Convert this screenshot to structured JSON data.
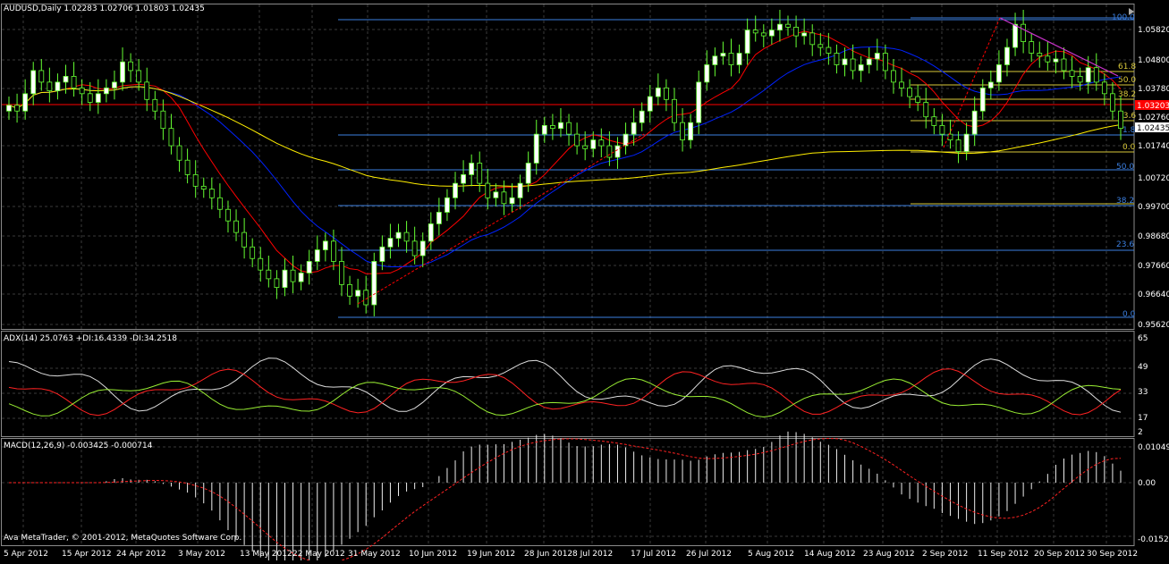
{
  "colors": {
    "background": "#000000",
    "grid": "#3a3a3a",
    "frame": "#8a8a8a",
    "bull_candle": "#ffffff",
    "bear_candle": "#000000",
    "candle_outline": "#66ff33",
    "ma_fast": "#ff0000",
    "ma_mid": "#0022ff",
    "ma_slow": "#ffee00",
    "fib_blue": "#3b7fe0",
    "fib_yellow": "#d8c83a",
    "trendline": "#cc33cc",
    "adx_main": "#dddddd",
    "plus_di": "#ff2222",
    "minus_di": "#99ee33",
    "macd_hist": "#eeeeee",
    "macd_signal": "#ff2222",
    "text": "#ffffff",
    "price_marker": "#ff0000"
  },
  "main_chart": {
    "title": "AUDUSD,Daily  1.02283 1.02706 1.01803 1.02435",
    "price_axis": [
      "1.05820",
      "1.04800",
      "1.03780",
      "1.02760",
      "1.01740",
      "1.00720",
      "0.99700",
      "0.98680",
      "0.97660",
      "0.96640",
      "0.95620"
    ],
    "current_price": "1.02435",
    "marker_price": "1.03203",
    "fib_left_labels": [
      "100.0",
      "61.8",
      "50.0",
      "38.2",
      "23.6",
      "0.0"
    ],
    "fib_right_labels": [
      "100.0",
      "61.8",
      "50.0",
      "38.2",
      "23.6",
      "0.0"
    ],
    "fib_right_secondary": [
      "1.8",
      "38.2"
    ],
    "icons": [
      "scroll-shift-icon"
    ]
  },
  "adx_panel": {
    "title": "ADX(14) 25.0763 +DI:16.4339 -DI:34.2518",
    "axis": [
      "65",
      "49",
      "33",
      "17",
      "2"
    ]
  },
  "macd_panel": {
    "title": "MACD(12,26,9) -0.003425 -0.000714",
    "axis": [
      "0.01049",
      "0.00",
      "-0.01525"
    ],
    "copyright": "Ava MetaTrader, © 2001-2012, MetaQuotes Software Corp."
  },
  "time_axis": [
    "5 Apr 2012",
    "15 Apr 2012",
    "24 Apr 2012",
    "3 May 2012",
    "13 May 2012",
    "22 May 2012",
    "31 May 2012",
    "10 Jun 2012",
    "19 Jun 2012",
    "28 Jun 2012",
    "8 Jul 2012",
    "17 Jul 2012",
    "26 Jul 2012",
    "5 Aug 2012",
    "14 Aug 2012",
    "23 Aug 2012",
    "2 Sep 2012",
    "11 Sep 2012",
    "20 Sep 2012",
    "30 Sep 2012"
  ]
}
